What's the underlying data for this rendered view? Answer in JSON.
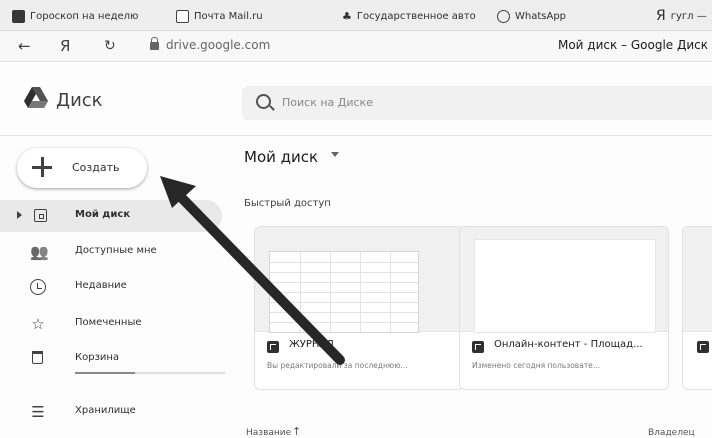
{
  "browser": {
    "tabs": [
      {
        "label": "Гороскоп на неделю"
      },
      {
        "label": "Почта Mail.ru"
      },
      {
        "label": "Государственное авто"
      },
      {
        "label": "WhatsApp"
      },
      {
        "label": "гугл —"
      }
    ],
    "nav": {
      "back": "←",
      "yandex": "Я",
      "reload": "↻"
    },
    "url": "drive.google.com",
    "page_title": "Мой диск – Google Диск"
  },
  "app": {
    "brand": "Диск",
    "search_placeholder": "Поиск на Диске"
  },
  "sidebar": {
    "create_label": "Создать",
    "items": [
      {
        "label": "Мой диск",
        "icon": "drive-icon",
        "active": true
      },
      {
        "label": "Доступные мне",
        "icon": "shared-people-icon"
      },
      {
        "label": "Недавние",
        "icon": "clock-icon"
      },
      {
        "label": "Помеченные",
        "icon": "star-icon"
      },
      {
        "label": "Корзина",
        "icon": "trash-icon"
      },
      {
        "label": "Хранилище",
        "icon": "storage-icon"
      }
    ]
  },
  "main": {
    "title": "Мой диск",
    "quick_access": "Быстрый доступ",
    "cards": [
      {
        "title": "ЖУРНАЛ",
        "subtitle": "Вы редактировали за последнюю..."
      },
      {
        "title": "Онлайн-контент - Площад...",
        "subtitle": "Изменено сегодня пользовате..."
      }
    ],
    "sort_label": "Название",
    "sort_arrow": "↑",
    "owner_label": "Владелец"
  },
  "colors": {
    "accent": "#444444",
    "background": "#f7f7f7"
  }
}
